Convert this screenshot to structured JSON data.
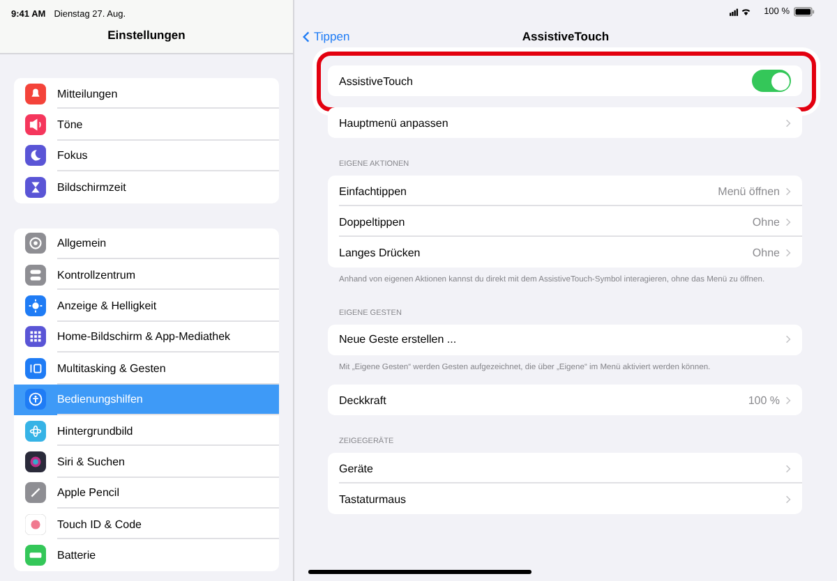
{
  "status_bar": {
    "time": "9:41 AM",
    "date": "Dienstag 27. Aug.",
    "battery": "100 %"
  },
  "sidebar": {
    "title": "Einstellungen",
    "groups": [
      {
        "items": [
          {
            "label": "Mitteilungen",
            "color": "#f4433a",
            "selected": false
          },
          {
            "label": "Töne",
            "color": "#f5365c",
            "selected": false
          },
          {
            "label": "Fokus",
            "color": "#5a55d6",
            "selected": false
          },
          {
            "label": "Bildschirmzeit",
            "color": "#5a55d6",
            "selected": false
          }
        ]
      },
      {
        "items": [
          {
            "label": "Allgemein",
            "color": "#8e8e93",
            "selected": false
          },
          {
            "label": "Kontrollzentrum",
            "color": "#8e8e93",
            "selected": false
          },
          {
            "label": "Anzeige & Helligkeit",
            "color": "#1f7cf5",
            "selected": false
          },
          {
            "label": "Home-Bildschirm & App-Mediathek",
            "color": "#5a55d6",
            "selected": false
          },
          {
            "label": "Multitasking & Gesten",
            "color": "#1f7cf5",
            "selected": false
          },
          {
            "label": "Bedienungshilfen",
            "color": "#1f7cf5",
            "selected": true
          },
          {
            "label": "Hintergrundbild",
            "color": "#36b3e6",
            "selected": false
          },
          {
            "label": "Siri & Suchen",
            "color": "#2a2a3a",
            "selected": false
          },
          {
            "label": "Apple Pencil",
            "color": "#8e8e93",
            "selected": false
          },
          {
            "label": "Touch ID & Code",
            "color": "#ffffff",
            "selected": false
          },
          {
            "label": "Batterie",
            "color": "#34c759",
            "selected": false
          }
        ]
      }
    ]
  },
  "detail": {
    "back": "Tippen",
    "title": "AssistiveTouch",
    "sections": [
      {
        "highlighted": true,
        "rows": [
          {
            "kind": "toggle",
            "label": "AssistiveTouch",
            "on": true
          }
        ]
      },
      {
        "rows": [
          {
            "kind": "link",
            "label": "Hauptmenü anpassen"
          }
        ]
      },
      {
        "header": "EIGENE AKTIONEN",
        "rows": [
          {
            "kind": "link",
            "label": "Einfachtippen",
            "value": "Menü öffnen"
          },
          {
            "kind": "link",
            "label": "Doppeltippen",
            "value": "Ohne"
          },
          {
            "kind": "link",
            "label": "Langes Drücken",
            "value": "Ohne"
          }
        ],
        "footer": "Anhand von eigenen Aktionen kannst du direkt mit dem AssistiveTouch-Symbol interagieren, ohne das Menü zu öffnen."
      },
      {
        "header": "EIGENE GESTEN",
        "rows": [
          {
            "kind": "link",
            "label": "Neue Geste erstellen ..."
          }
        ],
        "footer": "Mit „Eigene Gesten“ werden Gesten aufgezeichnet, die über „Eigene“ im Menü aktiviert werden können."
      },
      {
        "rows": [
          {
            "kind": "link",
            "label": "Deckkraft",
            "value": "100 %"
          }
        ]
      },
      {
        "header": "ZEIGEGERÄTE",
        "rows": [
          {
            "kind": "link",
            "label": "Geräte"
          },
          {
            "kind": "link",
            "label": "Tastaturmaus"
          }
        ]
      }
    ]
  }
}
